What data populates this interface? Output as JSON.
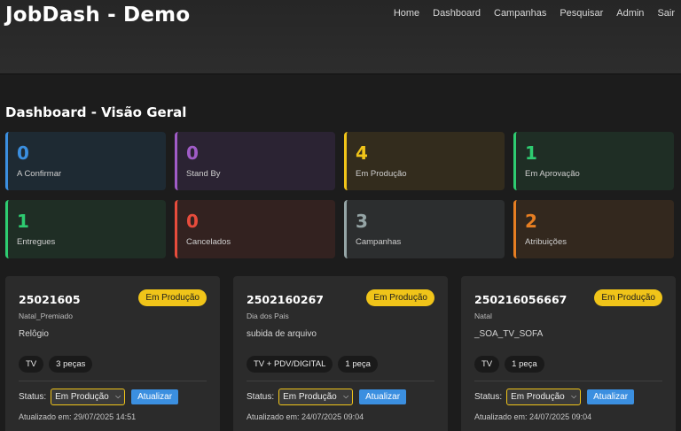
{
  "header": {
    "brand": "JobDash - Demo",
    "nav": [
      "Home",
      "Dashboard",
      "Campanhas",
      "Pesquisar",
      "Admin",
      "Sair"
    ]
  },
  "page": {
    "title": "Dashboard - Visão Geral"
  },
  "stats": [
    {
      "value": "0",
      "label": "A Confirmar",
      "color": "#3b8fe0",
      "bg": "#1e2a33"
    },
    {
      "value": "0",
      "label": "Stand By",
      "color": "#a05cc7",
      "bg": "#2b2333"
    },
    {
      "value": "4",
      "label": "Em Produção",
      "color": "#f0c419",
      "bg": "#332c1d"
    },
    {
      "value": "1",
      "label": "Em Aprovação",
      "color": "#2ecc71",
      "bg": "#1f2e25"
    },
    {
      "value": "1",
      "label": "Entregues",
      "color": "#2ecc71",
      "bg": "#1f2e25"
    },
    {
      "value": "0",
      "label": "Cancelados",
      "color": "#e74c3c",
      "bg": "#332220"
    },
    {
      "value": "3",
      "label": "Campanhas",
      "color": "#95a5a6",
      "bg": "#2c2e2f"
    },
    {
      "value": "2",
      "label": "Atribuições",
      "color": "#e67e22",
      "bg": "#33281e"
    }
  ],
  "jobs": [
    {
      "code": "25021605",
      "badge": "Em Produção",
      "campaign": "Natal_Premiado",
      "title": "Relôgio",
      "tags": [
        "TV",
        "3 peças"
      ],
      "status_label": "Status:",
      "status_value": "Em Produção",
      "button": "Atualizar",
      "updated": "Atualizado em: 29/07/2025 14:51"
    },
    {
      "code": "2502160267",
      "badge": "Em Produção",
      "campaign": "Dia dos Pais",
      "title": "subida de arquivo",
      "tags": [
        "TV + PDV/DIGITAL",
        "1 peça"
      ],
      "status_label": "Status:",
      "status_value": "Em Produção",
      "button": "Atualizar",
      "updated": "Atualizado em: 24/07/2025 09:04"
    },
    {
      "code": "250216056667",
      "badge": "Em Produção",
      "campaign": "Natal",
      "title": "_SOA_TV_SOFA",
      "tags": [
        "TV",
        "1 peça"
      ],
      "status_label": "Status:",
      "status_value": "Em Produção",
      "button": "Atualizar",
      "updated": "Atualizado em: 24/07/2025 09:04"
    }
  ]
}
